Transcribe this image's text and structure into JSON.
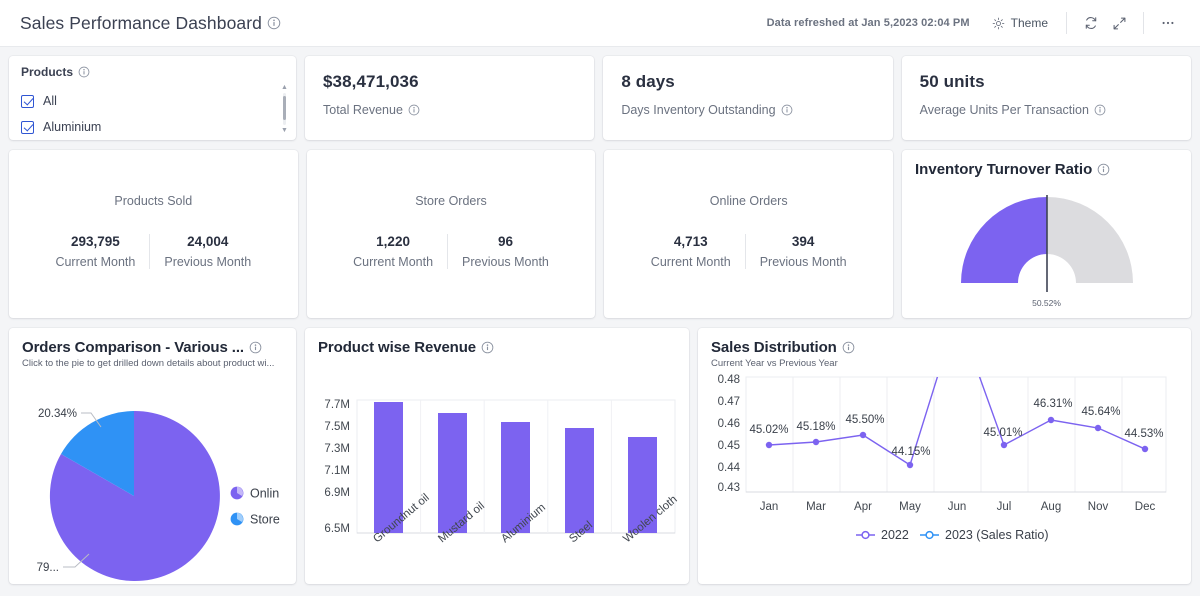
{
  "header": {
    "title": "Sales Performance Dashboard",
    "refreshed_text": "Data refreshed at Jan 5,2023 02:04 PM",
    "theme_label": "Theme",
    "icons": {
      "sun": "sun-icon",
      "refresh": "refresh-icon",
      "expand": "expand-icon",
      "more": "more-options-icon"
    }
  },
  "filter": {
    "title": "Products",
    "items": [
      {
        "label": "All",
        "checked": true
      },
      {
        "label": "Aluminium",
        "checked": true
      }
    ]
  },
  "kpis": [
    {
      "value": "$38,471,036",
      "label": "Total Revenue"
    },
    {
      "value": "8 days",
      "label": "Days Inventory Outstanding"
    },
    {
      "value": "50 units",
      "label": "Average Units Per Transaction"
    }
  ],
  "comparisons": [
    {
      "title": "Products Sold",
      "current": "293,795",
      "previous": "24,004",
      "current_label": "Current Month",
      "previous_label": "Previous Month"
    },
    {
      "title": "Store Orders",
      "current": "1,220",
      "previous": "96",
      "current_label": "Current Month",
      "previous_label": "Previous Month"
    },
    {
      "title": "Online Orders",
      "current": "4,713",
      "previous": "394",
      "current_label": "Current Month",
      "previous_label": "Previous Month"
    }
  ],
  "gauge": {
    "title": "Inventory Turnover Ratio",
    "value_label": "50.52%",
    "value": 50.52,
    "fill_color": "#7c63f0",
    "track_color": "#dcdcdf"
  },
  "pie_card": {
    "title": "Orders Comparison - Various ...",
    "subtitle": "Click to the pie to get drilled down details about product wi..."
  },
  "bar_card": {
    "title": "Product wise Revenue"
  },
  "line_card": {
    "title": "Sales Distribution",
    "subtitle": "Current Year vs Previous Year"
  },
  "chart_data": [
    {
      "type": "pie",
      "title": "Orders Comparison - Various ...",
      "labels": [
        "Onlin",
        "Store"
      ],
      "values": [
        79.66,
        20.34
      ],
      "value_labels": [
        "79...",
        "20.34%"
      ],
      "colors": [
        "#7c63f0",
        "#2f92f5"
      ],
      "legend": "right"
    },
    {
      "type": "bar",
      "title": "Product wise Revenue",
      "categories": [
        "Groundnut oil",
        "Mustard oil",
        "Aluminium",
        "Steel",
        "Woolen cloth"
      ],
      "values": [
        7780000,
        7660000,
        7570000,
        7505000,
        7420000
      ],
      "ytick_labels": [
        "7.7M",
        "7.5M",
        "7.3M",
        "7.1M",
        "6.9M",
        "6.5M"
      ],
      "ylim": [
        6500000,
        7800000
      ],
      "xlabel": "",
      "ylabel": "",
      "color": "#7c63f0",
      "grid": true
    },
    {
      "type": "line",
      "title": "Sales Distribution",
      "subtitle": "Current Year vs Previous Year",
      "categories": [
        "Jan",
        "Mar",
        "Apr",
        "May",
        "Jun",
        "Jul",
        "Aug",
        "Nov",
        "Dec"
      ],
      "ytick_labels": [
        "0.48",
        "0.47",
        "0.46",
        "0.45",
        "0.44",
        "0.43"
      ],
      "ylim": [
        0.43,
        0.48
      ],
      "series": [
        {
          "name": "2022",
          "color": "#7c63f0",
          "values": [
            0.4502,
            0.4518,
            0.455,
            0.4415,
            0.52,
            0.4501,
            0.4631,
            0.4564,
            0.4453
          ],
          "data_labels": [
            "45.02%",
            "45.18%",
            "45.50%",
            "44.15%",
            "",
            "45.01%",
            "46.31%",
            "45.64%",
            "44.53%"
          ]
        },
        {
          "name": "2023 (Sales Ratio)",
          "color": "#2f92f5",
          "values": [],
          "data_labels": []
        }
      ],
      "legend": "bottom"
    }
  ]
}
